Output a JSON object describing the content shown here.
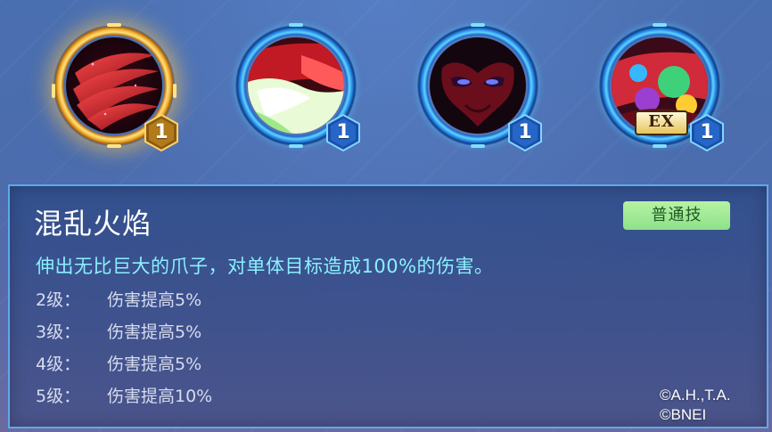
{
  "skills": [
    {
      "name": "claw-skill",
      "level_badge": "1",
      "ring_color": "gold",
      "selected": true,
      "ex": ""
    },
    {
      "name": "flame-skill",
      "level_badge": "1",
      "ring_color": "blue",
      "selected": false,
      "ex": ""
    },
    {
      "name": "mask-skill",
      "level_badge": "1",
      "ring_color": "blue",
      "selected": false,
      "ex": ""
    },
    {
      "name": "ex-skill",
      "level_badge": "1",
      "ring_color": "blue",
      "selected": false,
      "ex": "EX"
    }
  ],
  "detail": {
    "title": "混乱火焰",
    "type_badge": "普通技",
    "description": "伸出无比巨大的爪子，对单体目标造成100%的伤害。",
    "levels": [
      {
        "label": "2级：",
        "effect": "伤害提高5%"
      },
      {
        "label": "3级：",
        "effect": "伤害提高5%"
      },
      {
        "label": "4级：",
        "effect": "伤害提高5%"
      },
      {
        "label": "5级：",
        "effect": "伤害提高10%"
      }
    ]
  },
  "copyright": {
    "line1": "©A.H.,T.A.",
    "line2": "©BNEI"
  },
  "colors": {
    "panel_border": "#5fa8ee",
    "description": "#8af0ff",
    "type_badge_bg": "#9fe895",
    "gold_ring": "#f3b43a",
    "blue_ring": "#2a8be8"
  }
}
